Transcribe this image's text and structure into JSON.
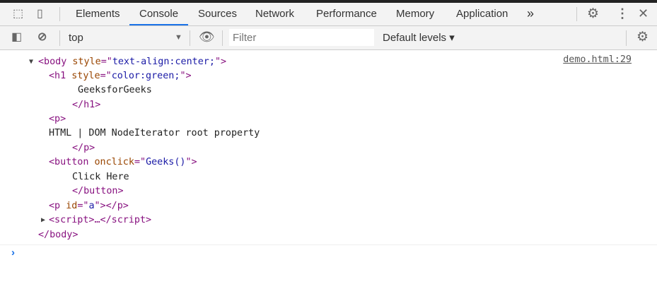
{
  "tabs": [
    "Elements",
    "Console",
    "Sources",
    "Network",
    "Performance",
    "Memory",
    "Application"
  ],
  "active_tab": "Console",
  "more_tabs": "»",
  "toolbar": {
    "context": "top",
    "filter_placeholder": "Filter",
    "levels": "Default levels ▾"
  },
  "source_link": "demo.html:29",
  "lines": {
    "l1": {
      "open": "<body",
      "attr": "style",
      "eq": "=\"",
      "val": "text-align:center;",
      "close": "\">"
    },
    "l2": {
      "open": "<h1",
      "attr": "style",
      "eq": "=\"",
      "val": "color:green;",
      "close": "\">"
    },
    "l3": "GeeksforGeeks",
    "l4": "</h1>",
    "l5": "<p>",
    "l6": "HTML | DOM NodeIterator root property",
    "l7": "</p>",
    "l8": {
      "open": "<button",
      "attr": "onclick",
      "eq": "=\"",
      "val": "Geeks()",
      "close": "\">"
    },
    "l9": "Click Here",
    "l10": "</button>",
    "l11": {
      "open": "<p",
      "attr": "id",
      "eq": "=\"",
      "val": "a",
      "close": "\"></p>"
    },
    "l12": "<script>…</script>",
    "l13": "</body>"
  },
  "prompt": "›",
  "accent": "#1a73e8"
}
